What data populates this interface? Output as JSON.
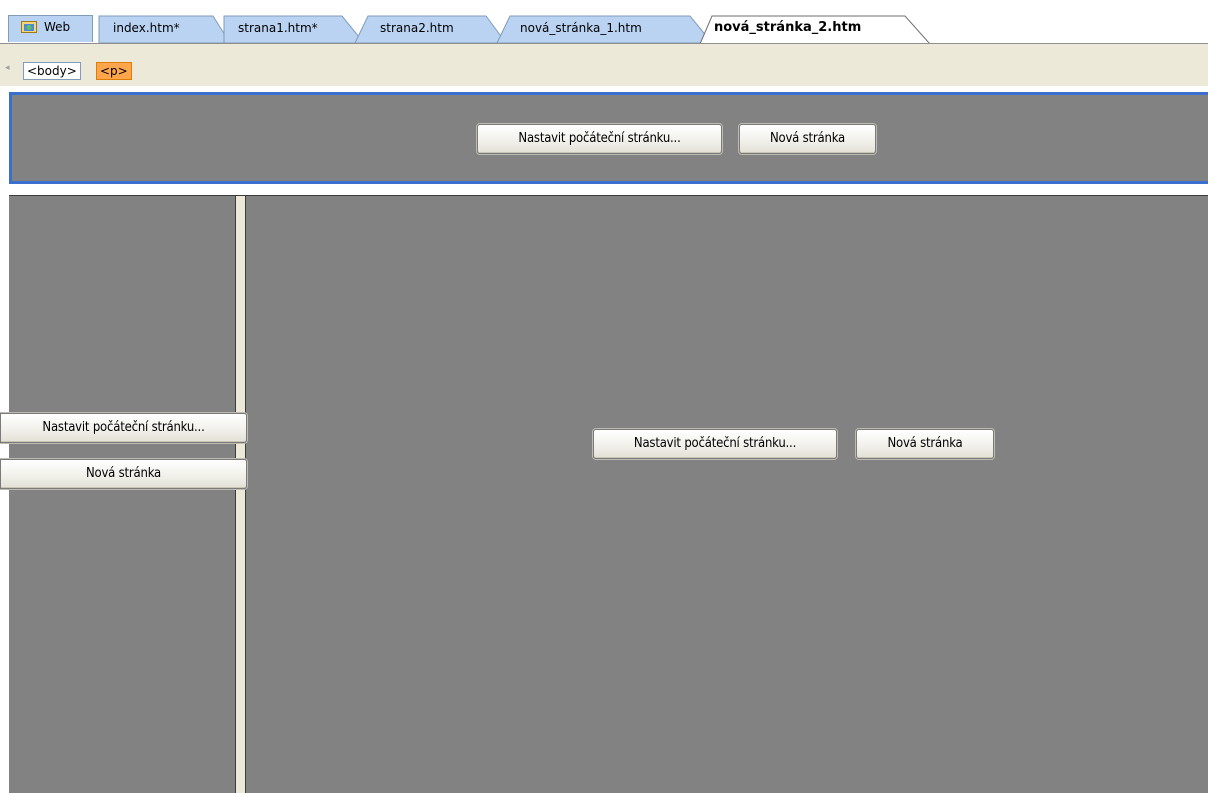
{
  "tabs": [
    {
      "label": "Web",
      "active": false
    },
    {
      "label": "index.htm*",
      "active": false
    },
    {
      "label": "strana1.htm*",
      "active": false
    },
    {
      "label": "strana2.htm",
      "active": false
    },
    {
      "label": "nová_stránka_1.htm",
      "active": false
    },
    {
      "label": "nová_stránka_2.htm",
      "active": true
    }
  ],
  "tagbar": {
    "tags": [
      "<body>",
      "<p>"
    ],
    "selected_tag": "<p>"
  },
  "frames": {
    "top": {
      "set_start_label": "Nastavit počáteční stránku...",
      "new_page_label": "Nová stránka"
    },
    "left": {
      "set_start_label": "Nastavit počáteční stránku...",
      "new_page_label": "Nová stránka"
    },
    "main": {
      "set_start_label": "Nastavit počáteční stránku...",
      "new_page_label": "Nová stránka"
    }
  },
  "colors": {
    "frame_bg": "#828282",
    "selected_frame_border": "#3a6fcf",
    "active_tag_bg": "#ffa64d",
    "tab_bg": "#bad3f2"
  },
  "icons": {
    "web_tab": "web-folder-icon"
  }
}
